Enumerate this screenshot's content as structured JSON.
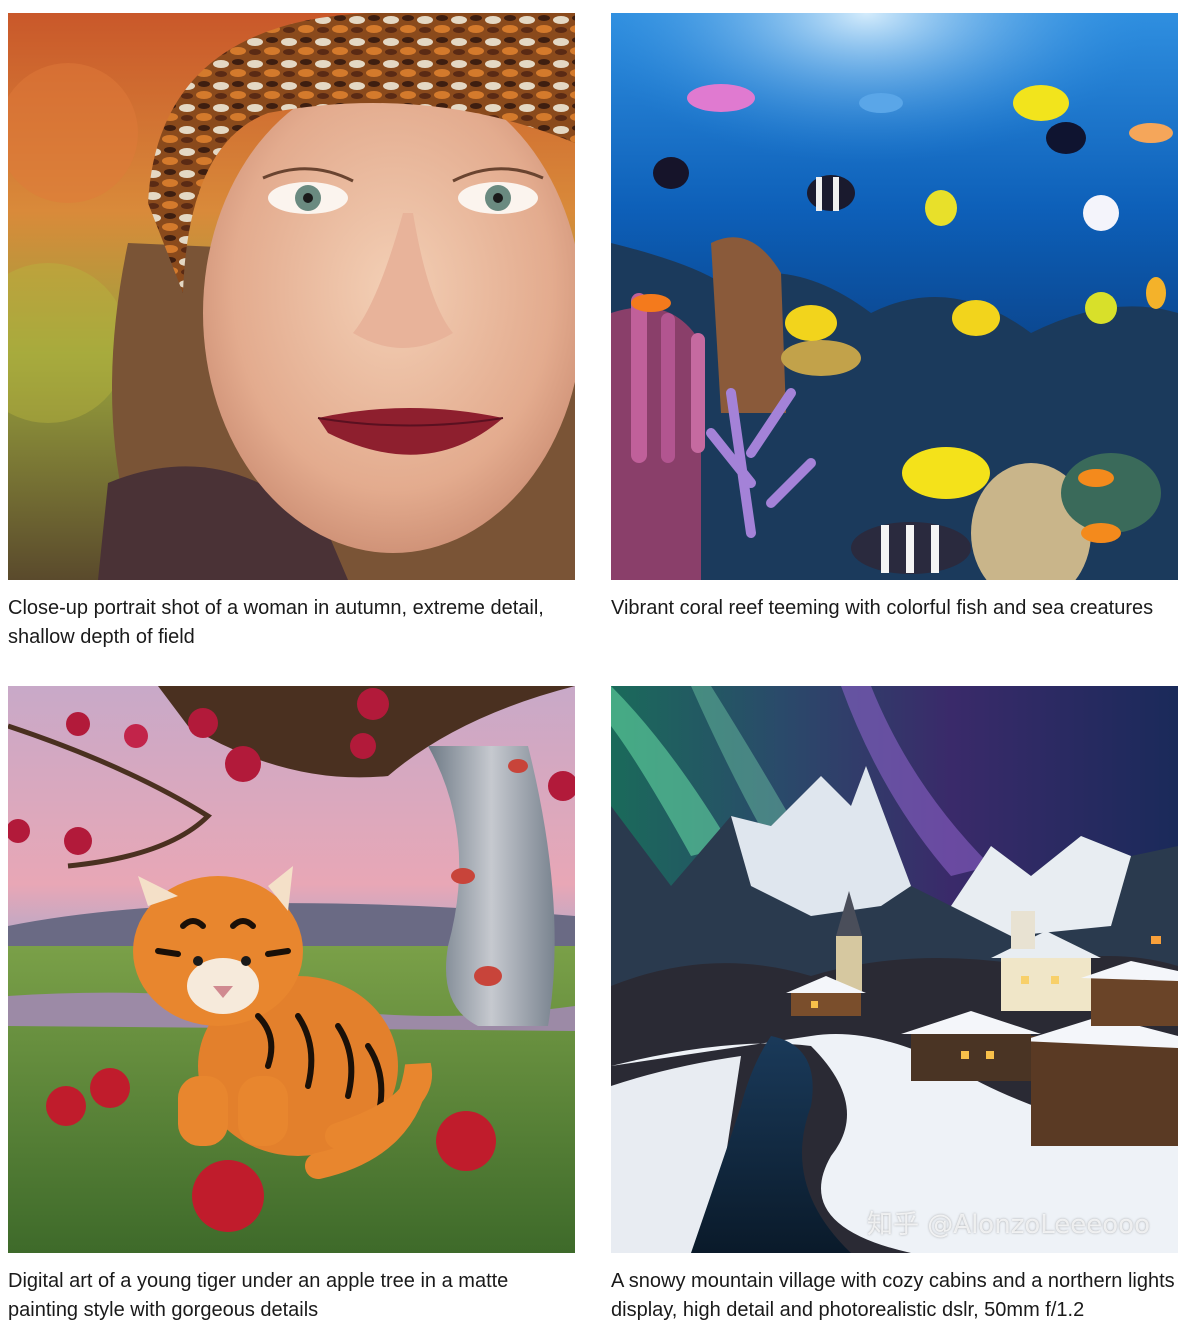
{
  "images": [
    {
      "caption": "Close-up portrait shot of a woman in autumn, extreme detail, shallow depth of field",
      "subject": "portrait-of-woman-in-knit-hat"
    },
    {
      "caption": "Vibrant coral reef teeming with colorful fish and sea creatures",
      "subject": "coral-reef-with-fish"
    },
    {
      "caption": "Digital art of a young tiger under an apple tree in a matte painting style with gorgeous details",
      "subject": "tiger-cub-under-apple-tree"
    },
    {
      "caption": "A snowy mountain village with cozy cabins and a northern lights display, high detail and photorealistic dslr, 50mm f/1.2",
      "subject": "snowy-village-northern-lights"
    }
  ],
  "watermark": "知乎 @AlonzoLeeeooo",
  "colors": {
    "text": "#1a1a1a",
    "background": "#ffffff"
  }
}
